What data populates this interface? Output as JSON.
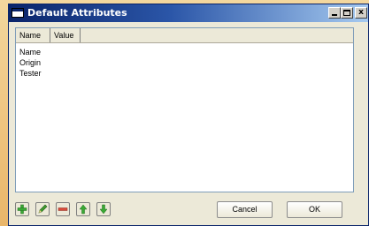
{
  "window": {
    "title": "Default Attributes",
    "controls": {
      "minimize": "_",
      "maximize": "□",
      "close": "x"
    }
  },
  "list": {
    "columns": [
      "Name",
      "Value"
    ],
    "rows": [
      {
        "name": "Name",
        "value": ""
      },
      {
        "name": "Origin",
        "value": ""
      },
      {
        "name": "Tester",
        "value": ""
      }
    ]
  },
  "toolbar": {
    "icons": [
      "add-icon",
      "edit-pencil-icon",
      "remove-icon",
      "move-up-icon",
      "move-down-icon"
    ],
    "colors": {
      "green": "#3aa935",
      "red": "#d94a3a",
      "pencil": "#3f9a2f"
    }
  },
  "buttons": {
    "cancel": "Cancel",
    "ok": "OK"
  }
}
